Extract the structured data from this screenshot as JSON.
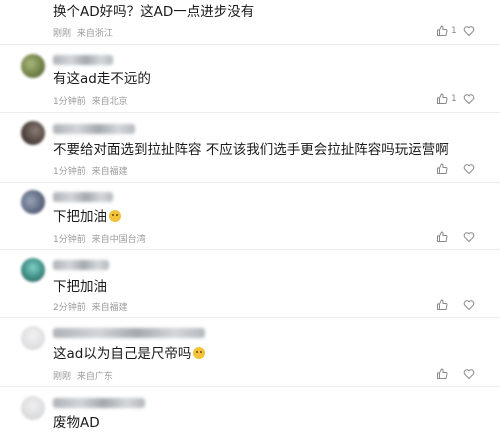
{
  "comments": [
    {
      "text": "换个AD好吗？这AD一点进步没有",
      "time": "刚刚",
      "location": "来自浙江",
      "likes": "1",
      "avatar_color": "#d8dadd"
    },
    {
      "text": "有这ad走不远的",
      "time": "1分钟前",
      "location": "来自北京",
      "likes": "1",
      "avatar_color": "#7b8c52"
    },
    {
      "text": "不要给对面选到拉扯阵容 不应该我们选手更会拉扯阵容吗玩运营啊",
      "time": "1分钟前",
      "location": "来自福建",
      "likes": "",
      "avatar_color": "#5d4f4a"
    },
    {
      "text": "下把加油",
      "time": "1分钟前",
      "location": "来自中国台湾",
      "likes": "",
      "avatar_color": "#6b7688",
      "emoji": "smiley-emoji"
    },
    {
      "text": "下把加油",
      "time": "2分钟前",
      "location": "来自福建",
      "likes": "",
      "avatar_color": "#3f8e86"
    },
    {
      "text": "这ad以为自己是尺帝吗",
      "time": "刚刚",
      "location": "来自广东",
      "likes": "",
      "avatar_color": "#e3e4e6",
      "emoji": "grin-emoji"
    },
    {
      "text": "废物AD",
      "time": "",
      "location": "",
      "likes": "",
      "avatar_color": "#e0e1e3"
    }
  ],
  "icons": {
    "like": "thumbs-up-icon",
    "heart": "heart-icon"
  },
  "colors": {
    "text": "#1a1a1a",
    "meta": "#9a9a9a",
    "icon": "#8a8a8a"
  }
}
